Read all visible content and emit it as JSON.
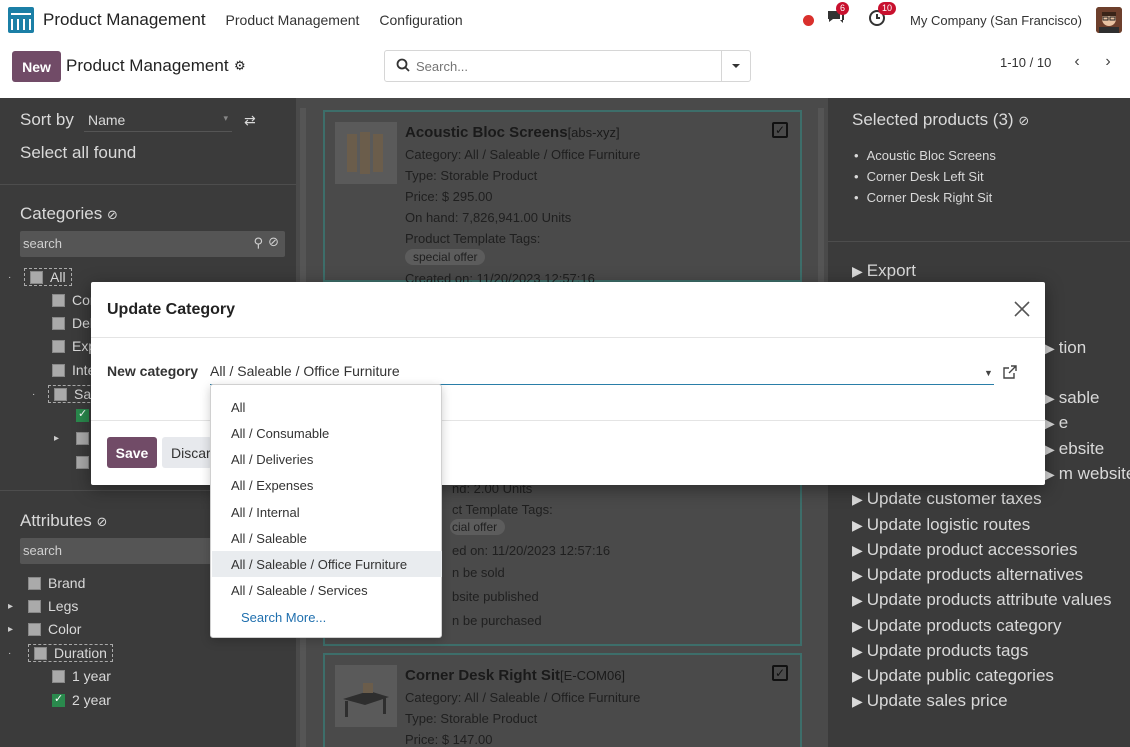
{
  "navbar": {
    "app_title": "Product Management",
    "menu": [
      "Product Management",
      "Configuration"
    ],
    "messages_badge": "6",
    "activity_badge": "10",
    "company": "My Company (San Francisco)"
  },
  "control": {
    "new_label": "New",
    "title": "Product Management",
    "search_placeholder": "Search...",
    "pager": "1-10 / 10"
  },
  "left": {
    "sort_label": "Sort by",
    "sort_value": "Name",
    "select_all": "Select all found",
    "categories_title": "Categories",
    "categories_search": "search",
    "tree": [
      {
        "label": "All",
        "checked": false
      },
      {
        "label": "Cor",
        "checked": false
      },
      {
        "label": "Del",
        "checked": false
      },
      {
        "label": "Exp",
        "checked": false
      },
      {
        "label": "Inte",
        "checked": false
      },
      {
        "label": "Sal",
        "checked": false
      }
    ],
    "attributes_title": "Attributes",
    "attributes_search": "search",
    "attributes": [
      "Brand",
      "Legs",
      "Color",
      "Duration"
    ],
    "duration_values": [
      "1 year",
      "2 year"
    ]
  },
  "cards": [
    {
      "name": "Acoustic Bloc Screens",
      "ref": "[abs-xyz]",
      "category": "Category: All / Saleable / Office Furniture",
      "type": "Type: Storable Product",
      "price": "Price: $ 295.00",
      "on_hand": "On hand: 7,826,941.00 Units",
      "tags_label": "Product Template Tags:",
      "tag": "special offer",
      "created": "Created on: 11/20/2023 12:57:16"
    },
    {
      "on_hand_frag": "nd: 2.00 Units",
      "tags_frag": "ct Template Tags:",
      "tag_frag": "cial offer",
      "created_frag": "ed on: 11/20/2023 12:57:16",
      "sold_frag": "n be sold",
      "published_frag": "bsite published",
      "purchased_frag": "n be purchased"
    },
    {
      "name": "Corner Desk Right Sit",
      "ref": "[E-COM06]",
      "category": "Category: All / Saleable / Office Furniture",
      "type": "Type: Storable Product",
      "price": "Price: $ 147.00"
    }
  ],
  "right": {
    "selected_title": "Selected products (3)",
    "selected": [
      "Acoustic Bloc Screens",
      "Corner Desk Left Sit",
      "Corner Desk Right Sit"
    ],
    "export": "Export",
    "partial_actions": [
      "tion",
      "sable",
      "e",
      "ebsite",
      "m website"
    ],
    "actions": [
      "Update customer taxes",
      "Update logistic routes",
      "Update product accessories",
      "Update products alternatives",
      "Update products attribute values",
      "Update products category",
      "Update products tags",
      "Update public categories",
      "Update sales price"
    ]
  },
  "modal": {
    "title": "Update Category",
    "field_label": "New category",
    "field_value": "All / Saleable / Office Furniture",
    "save": "Save",
    "discard": "Discard"
  },
  "dropdown": {
    "options": [
      "All",
      "All / Consumable",
      "All / Deliveries",
      "All / Expenses",
      "All / Internal",
      "All / Saleable",
      "All / Saleable / Office Furniture",
      "All / Saleable / Services"
    ],
    "selected": "All / Saleable / Office Furniture",
    "search_more": "Search More..."
  },
  "colors": {
    "brand": "#714b67",
    "link": "#1f6fae",
    "focus_underline": "#2a7ea8"
  }
}
